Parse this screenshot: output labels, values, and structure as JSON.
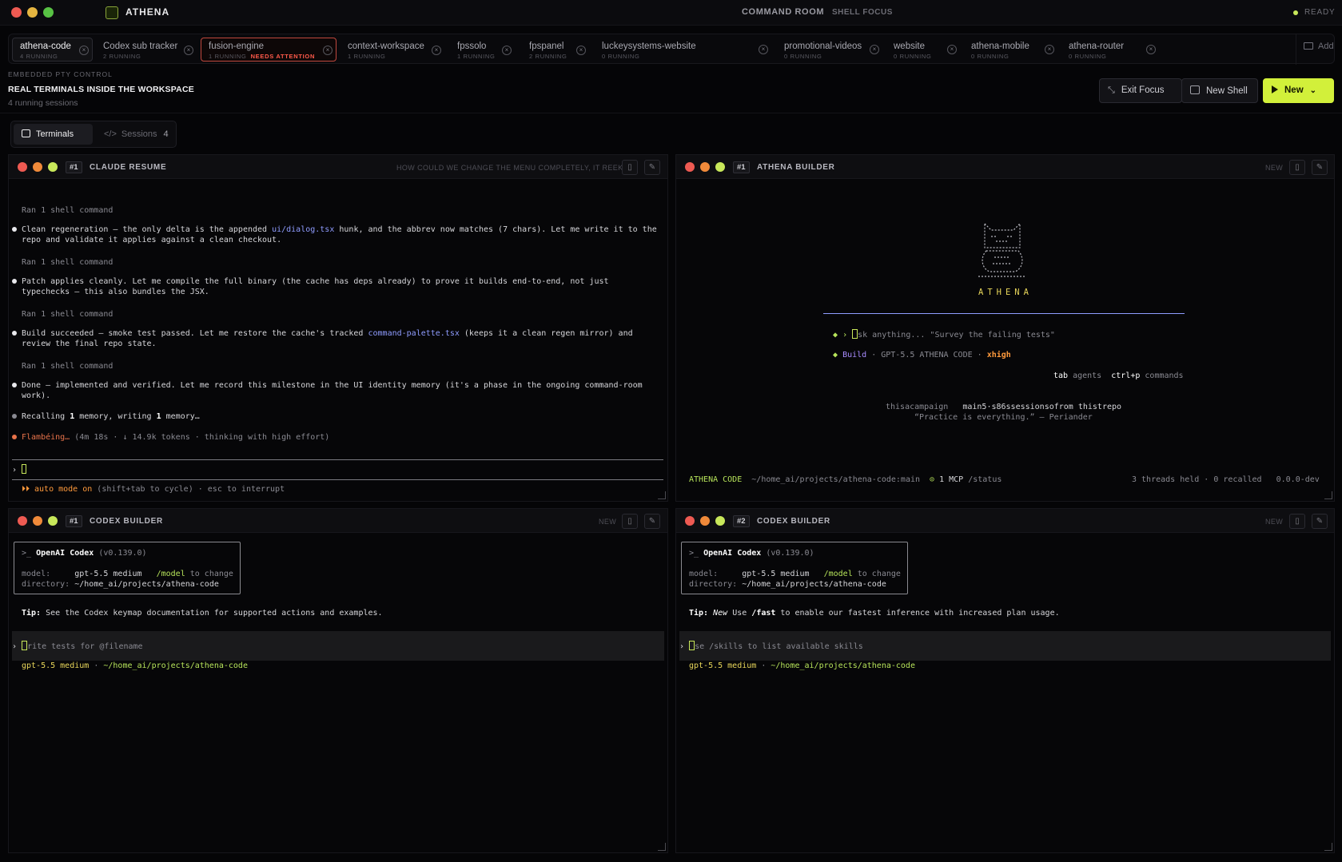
{
  "titlebar": {
    "app_name": "ATHENA",
    "center_title": "COMMAND ROOM",
    "center_sub": "SHELL FOCUS",
    "status": "READY",
    "traffic_colors": [
      "#ee5a52",
      "#e5b540",
      "#58c244"
    ]
  },
  "tabs": [
    {
      "name": "athena-code",
      "status": "4 RUNNING",
      "warn": "",
      "state": "active"
    },
    {
      "name": "Codex sub tracker",
      "status": "2 RUNNING",
      "warn": "",
      "state": ""
    },
    {
      "name": "fusion-engine",
      "status": "1 RUNNING",
      "warn": "NEEDS ATTENTION",
      "state": "attn"
    },
    {
      "name": "context-workspace",
      "status": "1 RUNNING",
      "warn": "",
      "state": ""
    },
    {
      "name": "fpssolo",
      "status": "1 RUNNING",
      "warn": "",
      "state": ""
    },
    {
      "name": "fpspanel",
      "status": "2 RUNNING",
      "warn": "",
      "state": ""
    },
    {
      "name": "luckeysystems-website",
      "status": "0 RUNNING",
      "warn": "",
      "state": ""
    },
    {
      "name": "promotional-videos",
      "status": "0 RUNNING",
      "warn": "",
      "state": ""
    },
    {
      "name": "website",
      "status": "0 RUNNING",
      "warn": "",
      "state": ""
    },
    {
      "name": "athena-mobile",
      "status": "0 RUNNING",
      "warn": "",
      "state": ""
    },
    {
      "name": "athena-router",
      "status": "0 RUNNING",
      "warn": "",
      "state": ""
    }
  ],
  "add_label": "Add",
  "header": {
    "kicker": "EMBEDDED PTY CONTROL",
    "headline": "REAL TERMINALS INSIDE THE WORKSPACE",
    "count": "4 running sessions",
    "exit_focus": "Exit Focus",
    "new_shell": "New Shell",
    "new": "New"
  },
  "segmented": {
    "terminals": "Terminals",
    "sessions": "Sessions",
    "sessions_count": "4"
  },
  "panes": {
    "p1": {
      "num": "#1",
      "name": "CLAUDE RESUME",
      "hint": "HOW COULD WE CHANGE THE MENU COMPLETELY, IT REEKS...",
      "ran": "Ran 1 shell command",
      "b1a": "Clean regeneration — the only delta is the appended ",
      "b1code": "ui/dialog.tsx",
      "b1b": " hunk, and the abbrev now matches (7 chars). Let me write it to the",
      "b1c": "repo and validate it applies against a clean checkout.",
      "b2a": "Patch applies cleanly. Let me compile the full binary (the cache has deps already) to prove it builds end-to-end, not just",
      "b2b": "typechecks — this also bundles the JSX.",
      "b3a": "Build succeeded — smoke test passed. Let me restore the cache's tracked ",
      "b3code": "command-palette.tsx",
      "b3b": " (keeps it a clean regen mirror) and",
      "b3c": "review the final repo state.",
      "b4a": "Done — implemented and verified. Let me record this milestone in the UI identity memory (it's a phase in the ongoing command-room",
      "b4b": "work).",
      "recall_a": "Recalling ",
      "recall_n1": "1",
      "recall_b": " memory, writing ",
      "recall_n2": "1",
      "recall_c": " memory…",
      "flamb": "Flambéing…",
      "flamb_meta": " (4m 18s · ↓ 14.9k tokens · thinking with high effort)",
      "prompt": "›",
      "auto_prefix": "⏵⏵ auto mode on",
      "auto_suffix": " (shift+tab to cycle) · esc to interrupt"
    },
    "p2": {
      "num": "#1",
      "name": "ATHENA BUILDER",
      "badge": "NEW",
      "logo": "ATHENA",
      "ask_prefix": "› ",
      "ask_text": "sk anything... \"Survey the failing tests\"",
      "build": "Build",
      "model": " · GPT-5.5 ATHENA CODE · ",
      "effort": "xhigh",
      "tab": "tab",
      "agents": " agents",
      "ctrlp": "ctrl+p",
      "commands": " commands",
      "tip_a": "thisacampaign",
      "tip_b": "main5·s86ssessionsofrom thistrepo",
      "quote": "“Practice is everything.” — Periander",
      "footer_brand": "ATHENA CODE",
      "footer_path": "~/home_ai/projects/athena-code:main",
      "mcp_icon": "⊙",
      "mcp": " 1 MCP",
      "status_cmd": " /status",
      "footer_right": "3 threads held · 0 recalled   0.0.0-dev"
    },
    "p3": {
      "num": "#1",
      "name": "CODEX BUILDER",
      "badge": "NEW",
      "prompt_glyph": ">_",
      "codex": "OpenAI Codex",
      "version": " (v0.139.0)",
      "model_label": "model:",
      "model_val": "gpt-5.5 medium",
      "model_cmd": "/model",
      "model_tail": " to change",
      "dir_label": "directory:",
      "dir_val": "~/home_ai/projects/athena-code",
      "tip_label": "Tip:",
      "tip_text": " See the Codex keymap documentation for supported actions and examples.",
      "input": "rite tests for @filename",
      "status_model": "gpt-5.5 medium",
      "status_sep": " · ",
      "status_path": "~/home_ai/projects/athena-code"
    },
    "p4": {
      "num": "#2",
      "name": "CODEX BUILDER",
      "badge": "NEW",
      "prompt_glyph": ">_",
      "codex": "OpenAI Codex",
      "version": " (v0.139.0)",
      "model_label": "model:",
      "model_val": "gpt-5.5 medium",
      "model_cmd": "/model",
      "model_tail": " to change",
      "dir_label": "directory:",
      "dir_val": "~/home_ai/projects/athena-code",
      "tip_label": "Tip:",
      "tip_new": "New",
      "tip_a": " Use ",
      "tip_cmd": "/fast",
      "tip_b": " to enable our fastest inference with increased plan usage.",
      "input": "se /skills to list available skills",
      "status_model": "gpt-5.5 medium",
      "status_sep": " · ",
      "status_path": "~/home_ai/projects/athena-code"
    }
  }
}
